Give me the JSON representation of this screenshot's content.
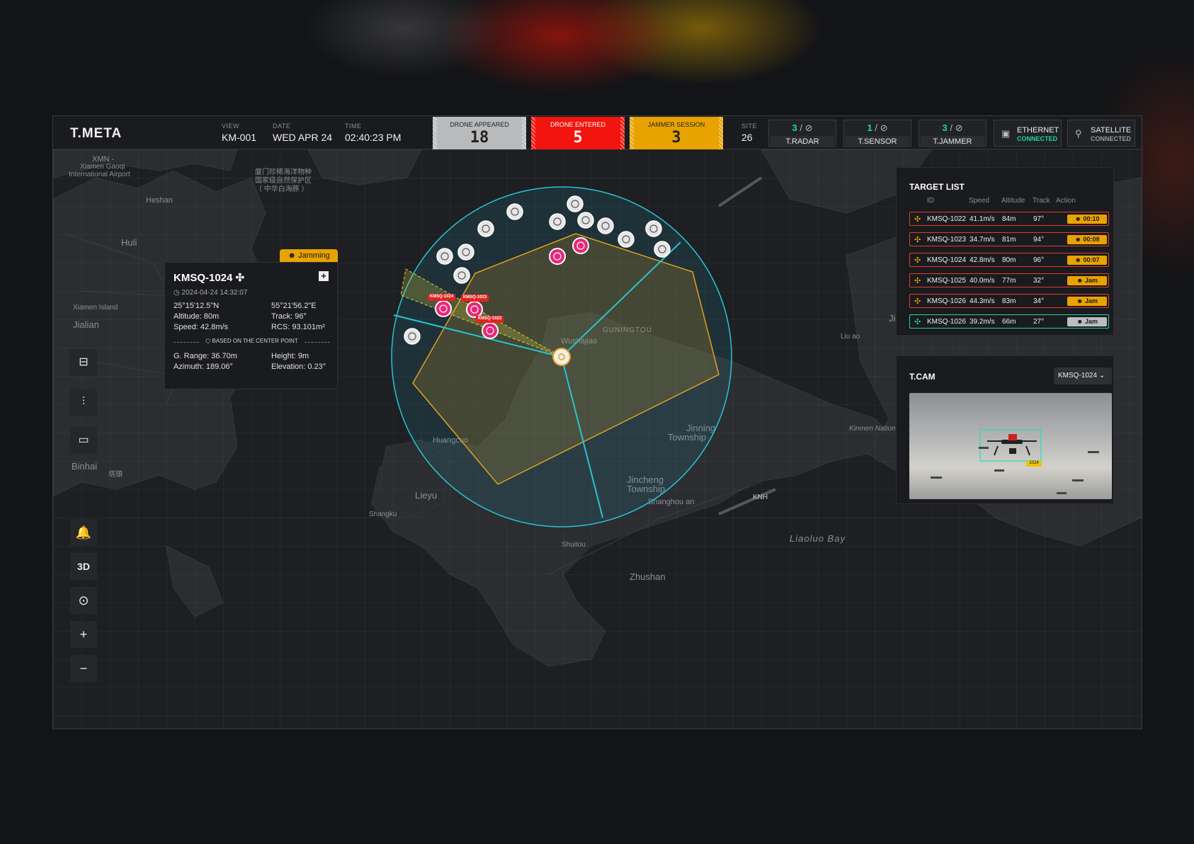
{
  "app": {
    "title": "T.META"
  },
  "header": {
    "view": {
      "label": "VIEW",
      "value": "KM-001"
    },
    "date": {
      "label": "DATE",
      "value": "WED APR 24"
    },
    "time": {
      "label": "TIME",
      "value": "02:40:23 PM"
    },
    "stats": [
      {
        "label": "DRONE APPEARED",
        "value": "18"
      },
      {
        "label": "DRONE ENTERED",
        "value": "5"
      },
      {
        "label": "JAMMER SESSION",
        "value": "3"
      }
    ],
    "site": {
      "label": "SITE",
      "value": "26"
    },
    "sensors": [
      {
        "count": "3",
        "sep": " / ",
        "name": "T.RADAR"
      },
      {
        "count": "1",
        "sep": " / ",
        "name": "T.SENSOR"
      },
      {
        "count": "3",
        "sep": " / ",
        "name": "T.JAMMER"
      }
    ],
    "connections": [
      {
        "name": "ETHERNET",
        "status": "CONNECTED",
        "color": "#1fd6a0",
        "icon": "network-icon"
      },
      {
        "name": "SATELLITE",
        "status": "CONNECTED",
        "color": "#9a9a9a",
        "icon": "satellite-icon"
      }
    ]
  },
  "map_labels": {
    "xmn": "XMN -",
    "airport1": "Xiamen Gaoqi",
    "airport2": "International Airport",
    "heshan": "Heshan",
    "huli": "Huli",
    "xiamen_island": "Xiamen Island",
    "jialian": "Jialian",
    "reserve1": "厦门珍稀海洋物种",
    "reserve2": "国家级自然保护区",
    "reserve3": "（ 中华白海豚 ）",
    "guningtou": "GUNINGTOU",
    "wushajiao": "Wushajiao",
    "jinning1": "Jinning",
    "jinning2": "Township",
    "huangcuo": "Huangcuo",
    "jincheng1": "Jincheng",
    "jincheng2": "Township",
    "shanghouan": "Shanghou an",
    "lieyu": "Lieyu",
    "shangku": "Shangku",
    "shuitou": "Shuitou",
    "zhushan": "Zhushan",
    "knh": "KNH",
    "liaoluo": "Liaoluo Bay",
    "kinmen": "Kinmen Nationa",
    "liuao": "Liu ao",
    "ji": "Ji",
    "binhai": "Binhai",
    "tatou": "塔頭"
  },
  "map_markers": {
    "labels": [
      "KMSQ-1024",
      "KMSQ-1023",
      "KMSQ-1022"
    ],
    "colors": {
      "radar": "#29c4d2",
      "zone": "#e3a020",
      "hostile": "#e8287a"
    }
  },
  "info_panel": {
    "tab": "Jamming",
    "title": "KMSQ-1024",
    "timestamp": "2024-04-24 14:32:07",
    "lat": "25°15'12.5\"N",
    "lon": "55°21'56.2\"E",
    "altitude": "Altitude: 80m",
    "track": "Track: 96°",
    "speed": "Speed: 42.8m/s",
    "rcs": "RCS: 93.101m²",
    "basis": "BASED ON THE CENTER POINT",
    "g_range": "G. Range: 36.70m",
    "height": "Height: 9m",
    "azimuth": "Azimuth: 189.06°",
    "elevation": "Elevation: 0.23°"
  },
  "tools": [
    {
      "name": "radar-device-tool",
      "icon": "radar-device-icon"
    },
    {
      "name": "equalizer-tool",
      "icon": "equalizer-icon"
    },
    {
      "name": "vehicle-tool",
      "icon": "vehicle-icon"
    }
  ],
  "controls": {
    "bell": "🔔",
    "threed": "3D",
    "compass": "⊙",
    "zoom_in": "+",
    "zoom_out": "−"
  },
  "target_list": {
    "title": "TARGET LIST",
    "columns": [
      "ID",
      "Speed",
      "Altitude",
      "Track",
      "Action"
    ],
    "rows": [
      {
        "id": "KMSQ-1022",
        "speed": "41.1m/s",
        "altitude": "84m",
        "track": "97°",
        "action": "00:10",
        "style": "red"
      },
      {
        "id": "KMSQ-1023",
        "speed": "34.7m/s",
        "altitude": "81m",
        "track": "94°",
        "action": "00:08",
        "style": "red"
      },
      {
        "id": "KMSQ-1024",
        "speed": "42.8m/s",
        "altitude": "80m",
        "track": "96°",
        "action": "00:07",
        "style": "red"
      },
      {
        "id": "KMSQ-1025",
        "speed": "40.0m/s",
        "altitude": "77m",
        "track": "32°",
        "action": "Jam",
        "style": "red"
      },
      {
        "id": "KMSQ-1026",
        "speed": "44.3m/s",
        "altitude": "83m",
        "track": "34°",
        "action": "Jam",
        "style": "red"
      },
      {
        "id": "KMSQ-1026",
        "speed": "39.2m/s",
        "altitude": "66m",
        "track": "27°",
        "action": "Jam",
        "style": "green"
      }
    ]
  },
  "tcam": {
    "title": "T.CAM",
    "selected": "KMSQ-1024",
    "box_label": "1024"
  }
}
